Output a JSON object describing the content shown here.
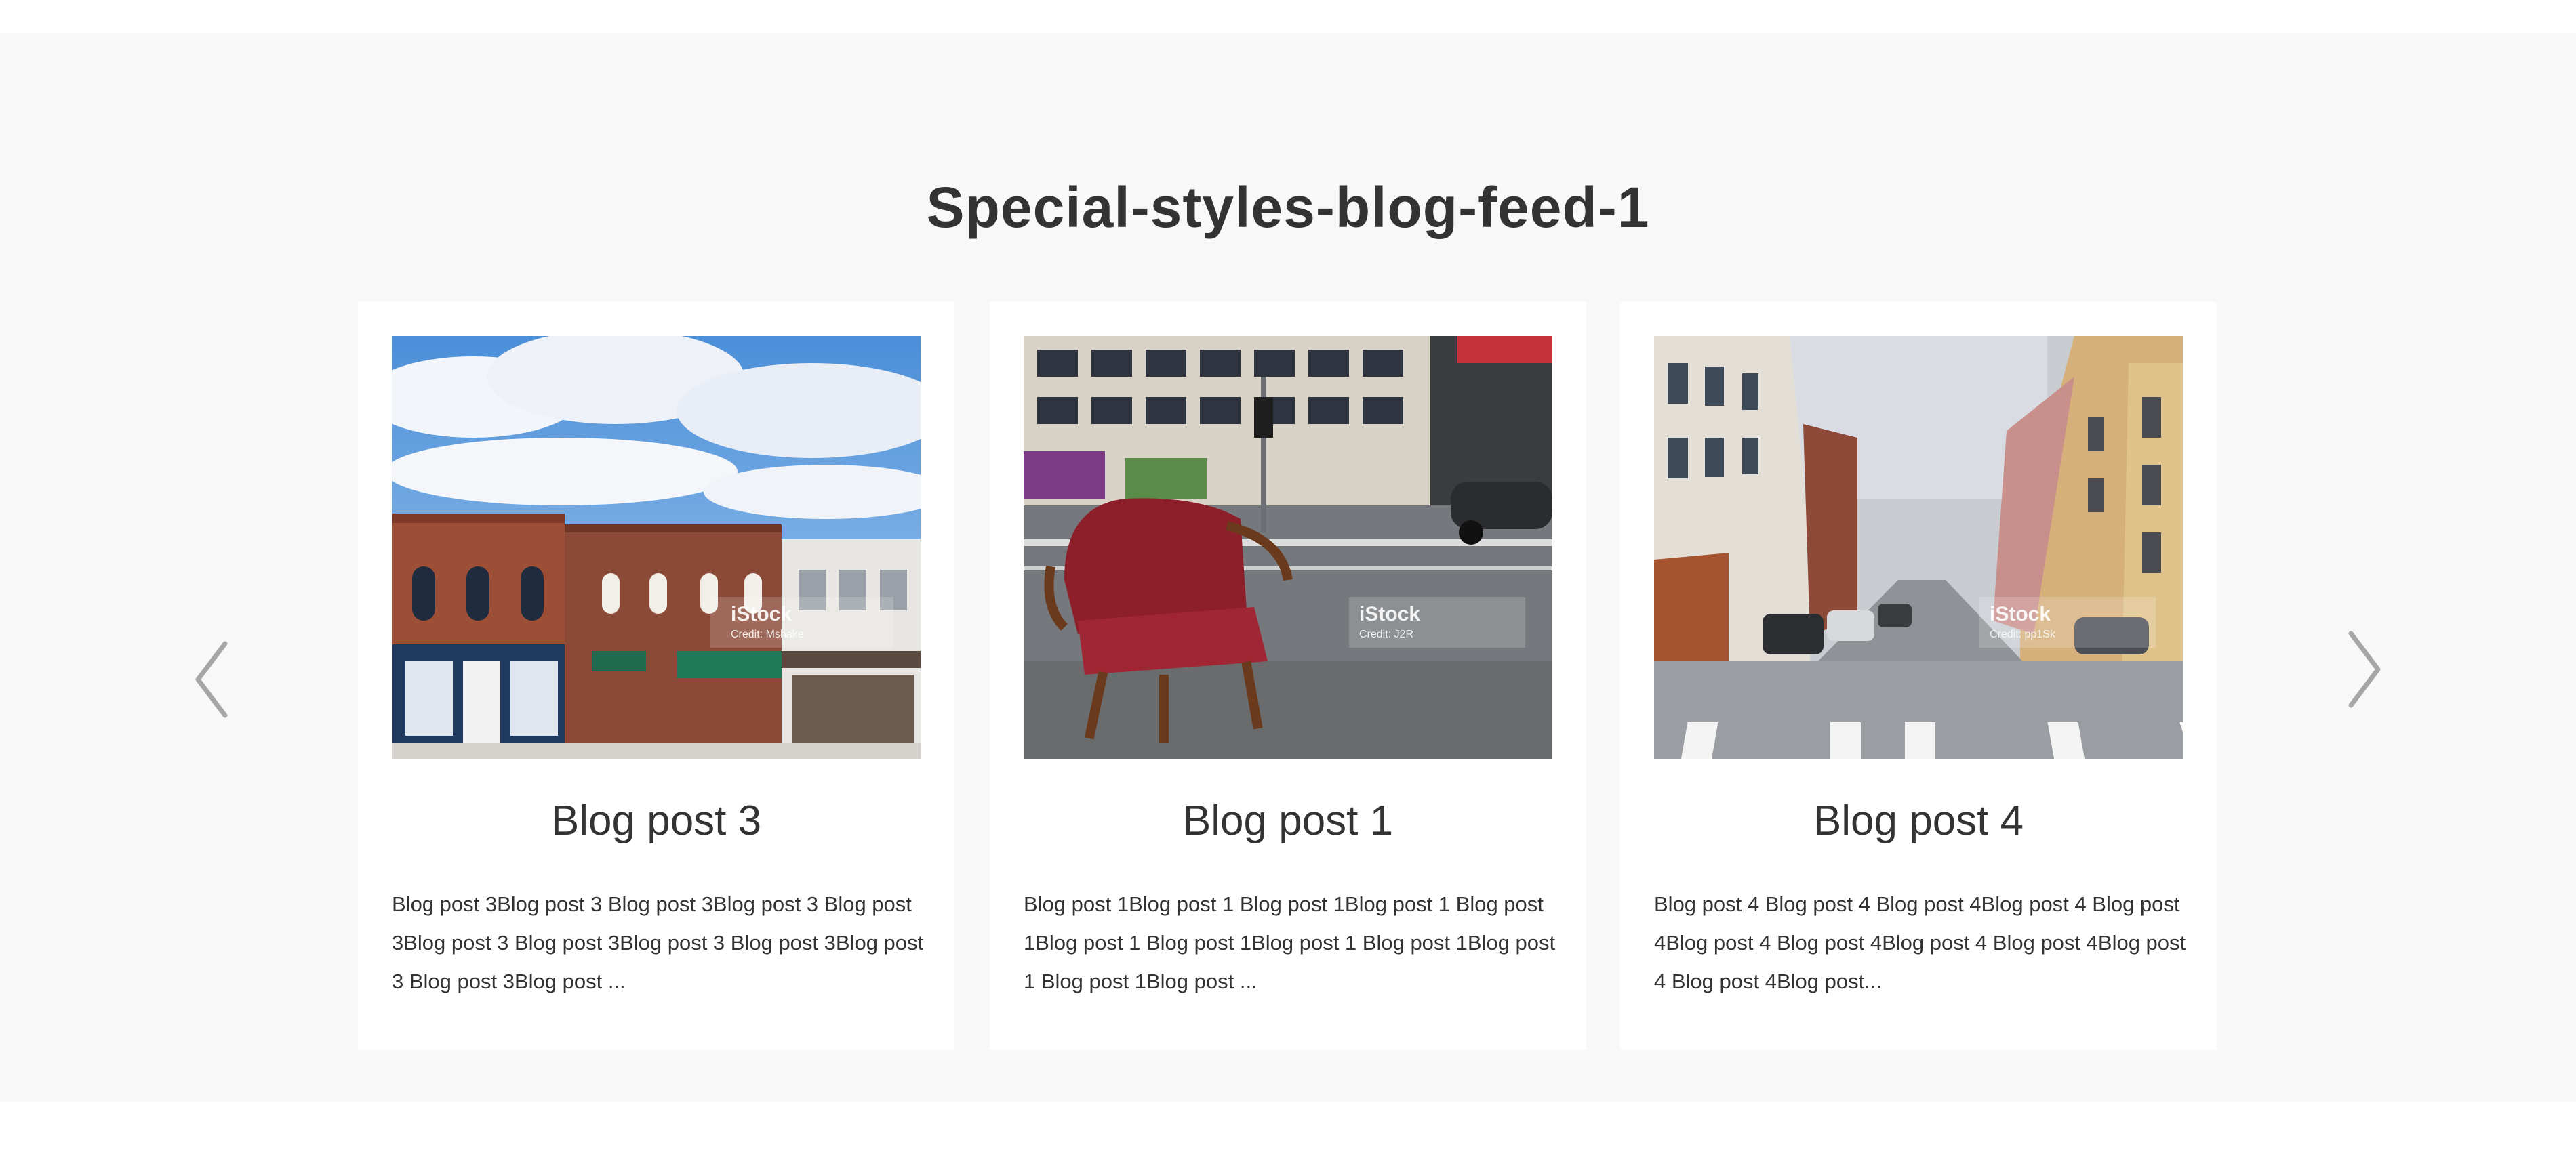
{
  "section": {
    "title": "Special-styles-blog-feed-1"
  },
  "carousel": {
    "prev_icon": "chevron-left-icon",
    "next_icon": "chevron-right-icon",
    "cards": [
      {
        "title": "Blog post 3",
        "excerpt": "Blog post 3Blog post 3 Blog post 3Blog post 3 Blog post 3Blog post 3 Blog post 3Blog post 3 Blog post 3Blog post 3 Blog post 3Blog post ...",
        "image": {
          "watermark_brand": "iStock",
          "watermark_credit": "Credit: Mshake"
        }
      },
      {
        "title": "Blog post 1",
        "excerpt": "Blog post 1Blog post 1 Blog post 1Blog post 1 Blog post 1Blog post 1 Blog post 1Blog post 1 Blog post 1Blog post 1 Blog post 1Blog post ...",
        "image": {
          "watermark_brand": "iStock",
          "watermark_credit": "Credit: J2R"
        }
      },
      {
        "title": "Blog post 4",
        "excerpt": "Blog post 4 Blog post 4 Blog post 4Blog post 4 Blog post 4Blog post 4 Blog post 4Blog post 4 Blog post 4Blog post 4 Blog post 4Blog post...",
        "image": {
          "watermark_brand": "iStock",
          "watermark_credit": "Credit: pp1Sk"
        }
      }
    ]
  },
  "colors": {
    "section_background": "#f8f8f8",
    "card_background": "#ffffff",
    "text": "#333333",
    "arrow": "#a6a6a6"
  }
}
